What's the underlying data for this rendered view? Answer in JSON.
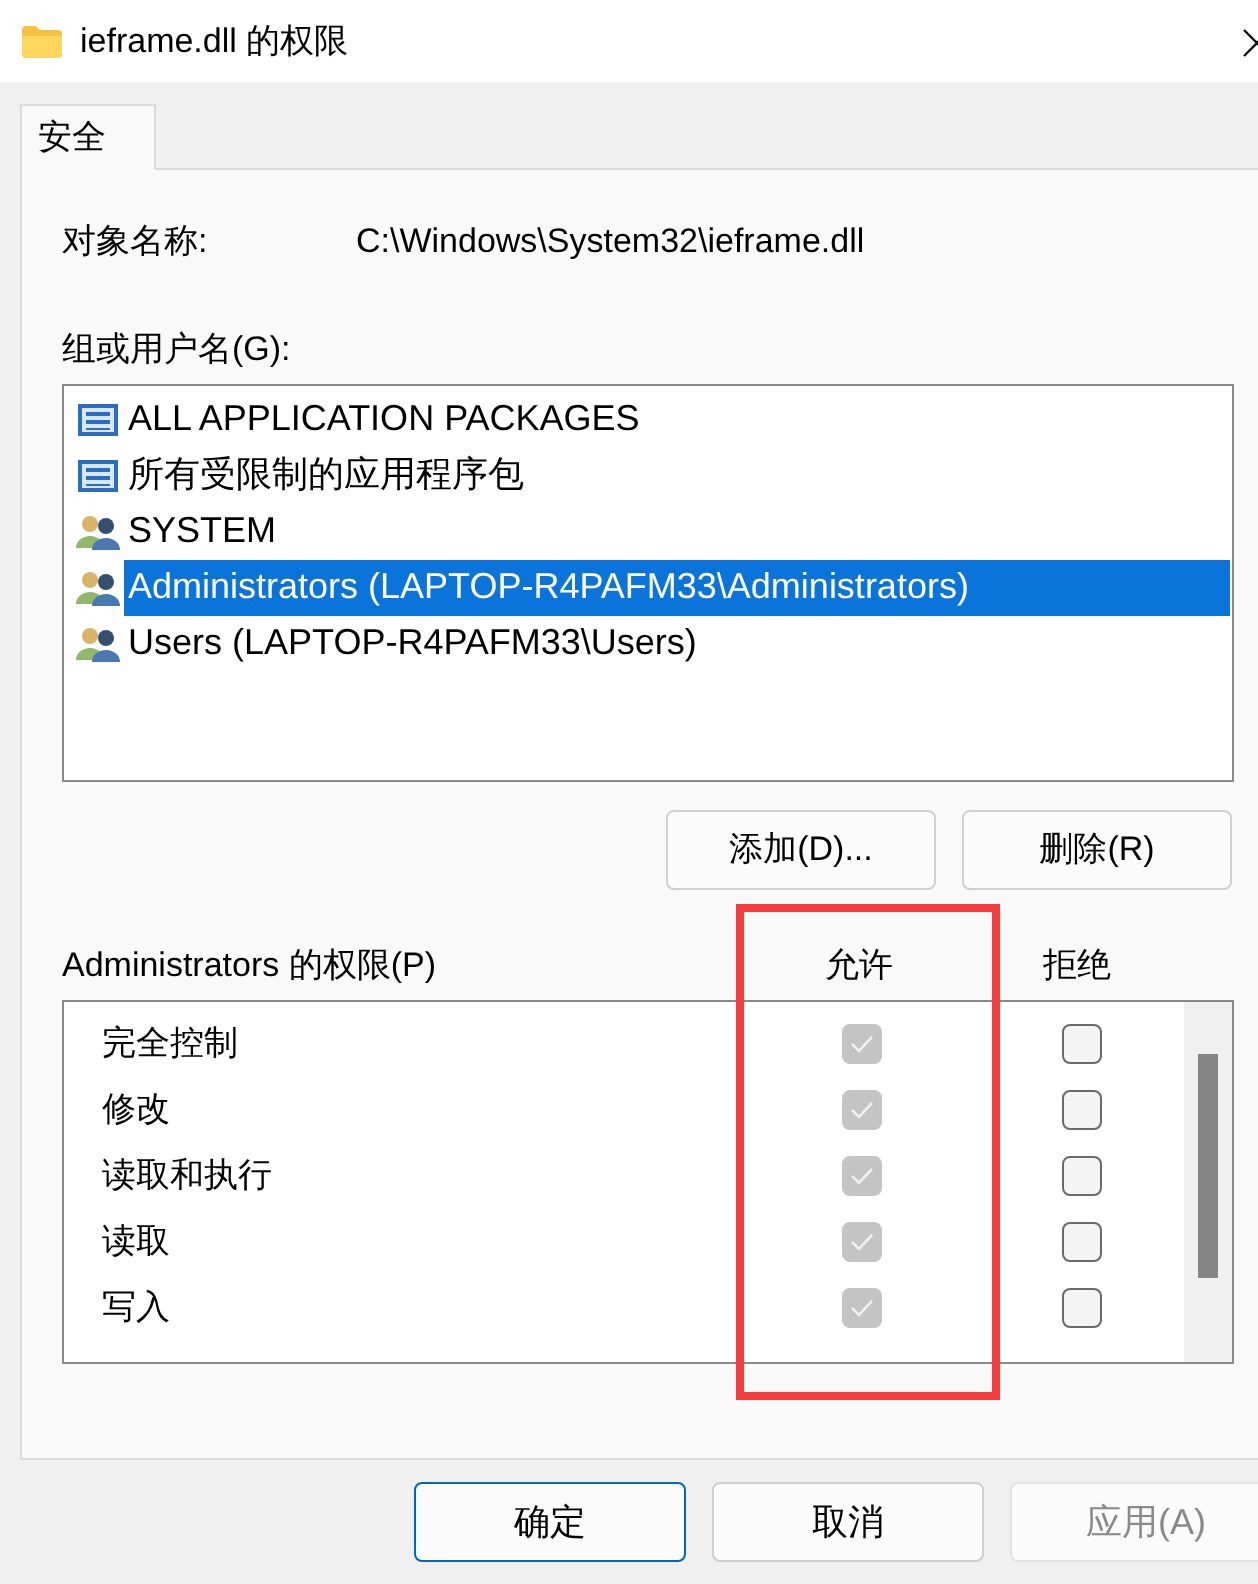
{
  "window": {
    "title": "ieframe.dll 的权限"
  },
  "tabs": [
    {
      "label": "安全",
      "selected": true
    }
  ],
  "object_name": {
    "label": "对象名称:",
    "value": "C:\\Windows\\System32\\ieframe.dll"
  },
  "groups": {
    "label": "组或用户名(G):",
    "items": [
      {
        "name": "ALL APPLICATION PACKAGES",
        "kind": "package",
        "selected": false
      },
      {
        "name": "所有受限制的应用程序包",
        "kind": "package",
        "selected": false
      },
      {
        "name": "SYSTEM",
        "kind": "user",
        "selected": false
      },
      {
        "name": "Administrators (LAPTOP-R4PAFM33\\Administrators)",
        "kind": "user",
        "selected": true
      },
      {
        "name": "Users (LAPTOP-R4PAFM33\\Users)",
        "kind": "user",
        "selected": false
      }
    ]
  },
  "group_buttons": [
    "添加(D)...",
    "删除(R)"
  ],
  "permissions": {
    "label": "Administrators 的权限(P)",
    "allow_header": "允许",
    "deny_header": "拒绝",
    "rows": [
      {
        "name": "完全控制",
        "allow": true,
        "deny": false
      },
      {
        "name": "修改",
        "allow": true,
        "deny": false
      },
      {
        "name": "读取和执行",
        "allow": true,
        "deny": false
      },
      {
        "name": "读取",
        "allow": true,
        "deny": false
      },
      {
        "name": "写入",
        "allow": true,
        "deny": false
      }
    ]
  },
  "highlight": true,
  "buttons": [
    {
      "label": "确定",
      "kind": "default",
      "disabled": false
    },
    {
      "label": "取消",
      "kind": "normal",
      "disabled": false
    },
    {
      "label": "应用(A)",
      "kind": "normal",
      "disabled": true
    }
  ]
}
